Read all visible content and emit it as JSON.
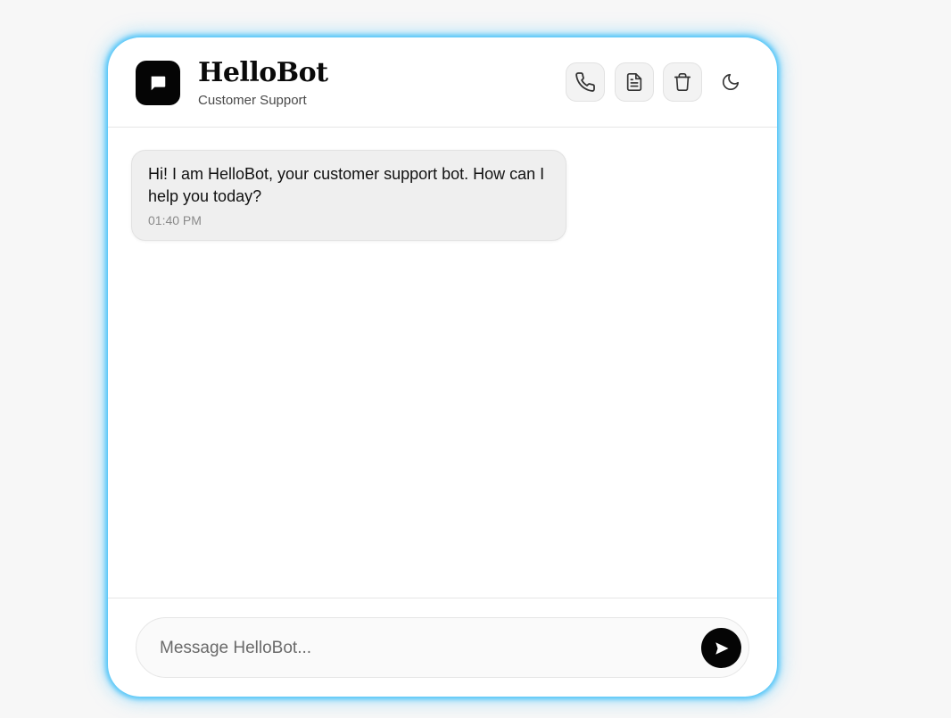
{
  "header": {
    "title": "HelloBot",
    "subtitle": "Customer Support",
    "logo_icon": "chat-bubble-icon",
    "actions": [
      {
        "name": "call",
        "icon": "phone-icon"
      },
      {
        "name": "transcript",
        "icon": "document-icon"
      },
      {
        "name": "clear",
        "icon": "trash-icon"
      },
      {
        "name": "theme",
        "icon": "moon-icon"
      }
    ]
  },
  "messages": [
    {
      "sender": "bot",
      "text": "Hi! I am HelloBot, your customer support bot. How can I help you today?",
      "time": "01:40 PM"
    }
  ],
  "composer": {
    "placeholder": "Message HelloBot...",
    "value": "",
    "send_icon": "send-icon"
  },
  "colors": {
    "accent_glow": "#38bdf8",
    "primary": "#050505",
    "bubble_bg": "#efefef",
    "page_bg": "#f7f7f7"
  }
}
